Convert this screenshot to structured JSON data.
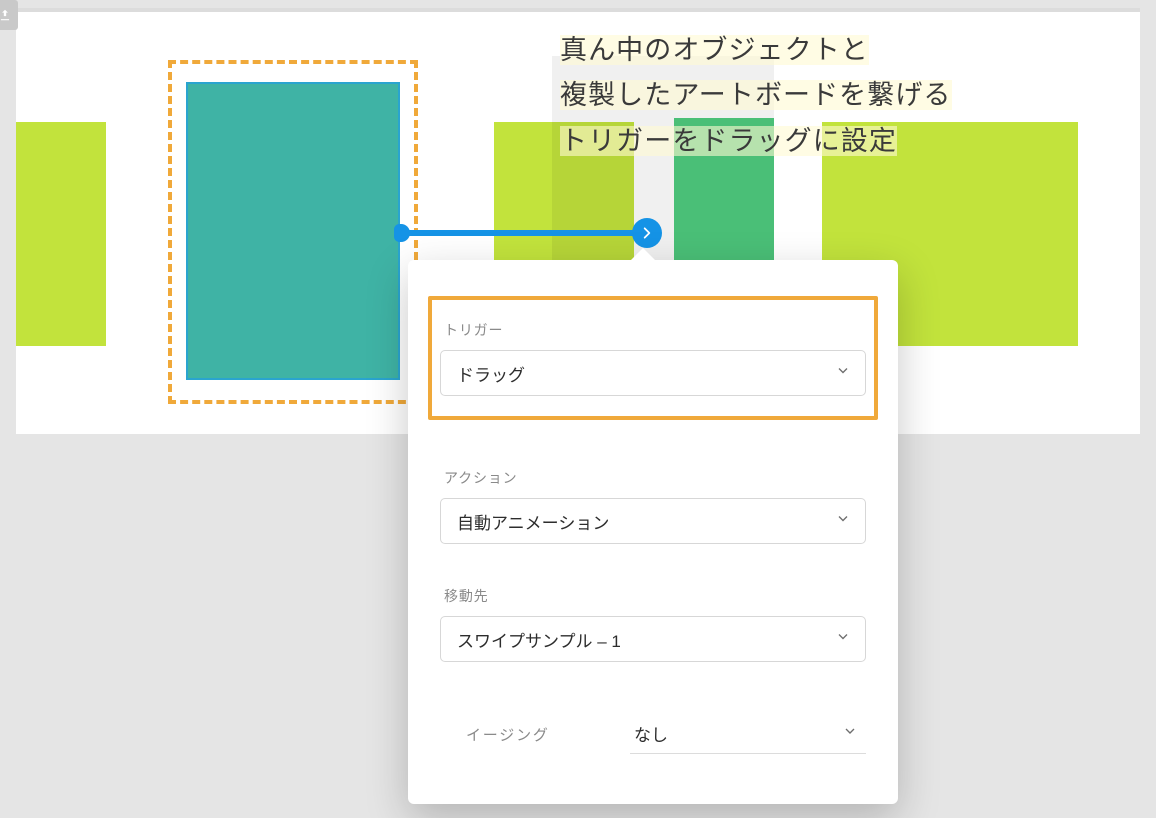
{
  "annotation": {
    "line1": "真ん中のオブジェクトと",
    "line2": "複製したアートボードを繋げる",
    "line3": "トリガーをドラッグに設定"
  },
  "popover": {
    "trigger": {
      "label": "トリガー",
      "value": "ドラッグ"
    },
    "action": {
      "label": "アクション",
      "value": "自動アニメーション"
    },
    "destination": {
      "label": "移動先",
      "value": "スワイプサンプル – 1"
    },
    "easing": {
      "label": "イージング",
      "value": "なし"
    }
  },
  "colors": {
    "selection": "#f0a93a",
    "connector": "#1593e6",
    "teal": "#3fb3a5",
    "green": "#c2e33c"
  }
}
